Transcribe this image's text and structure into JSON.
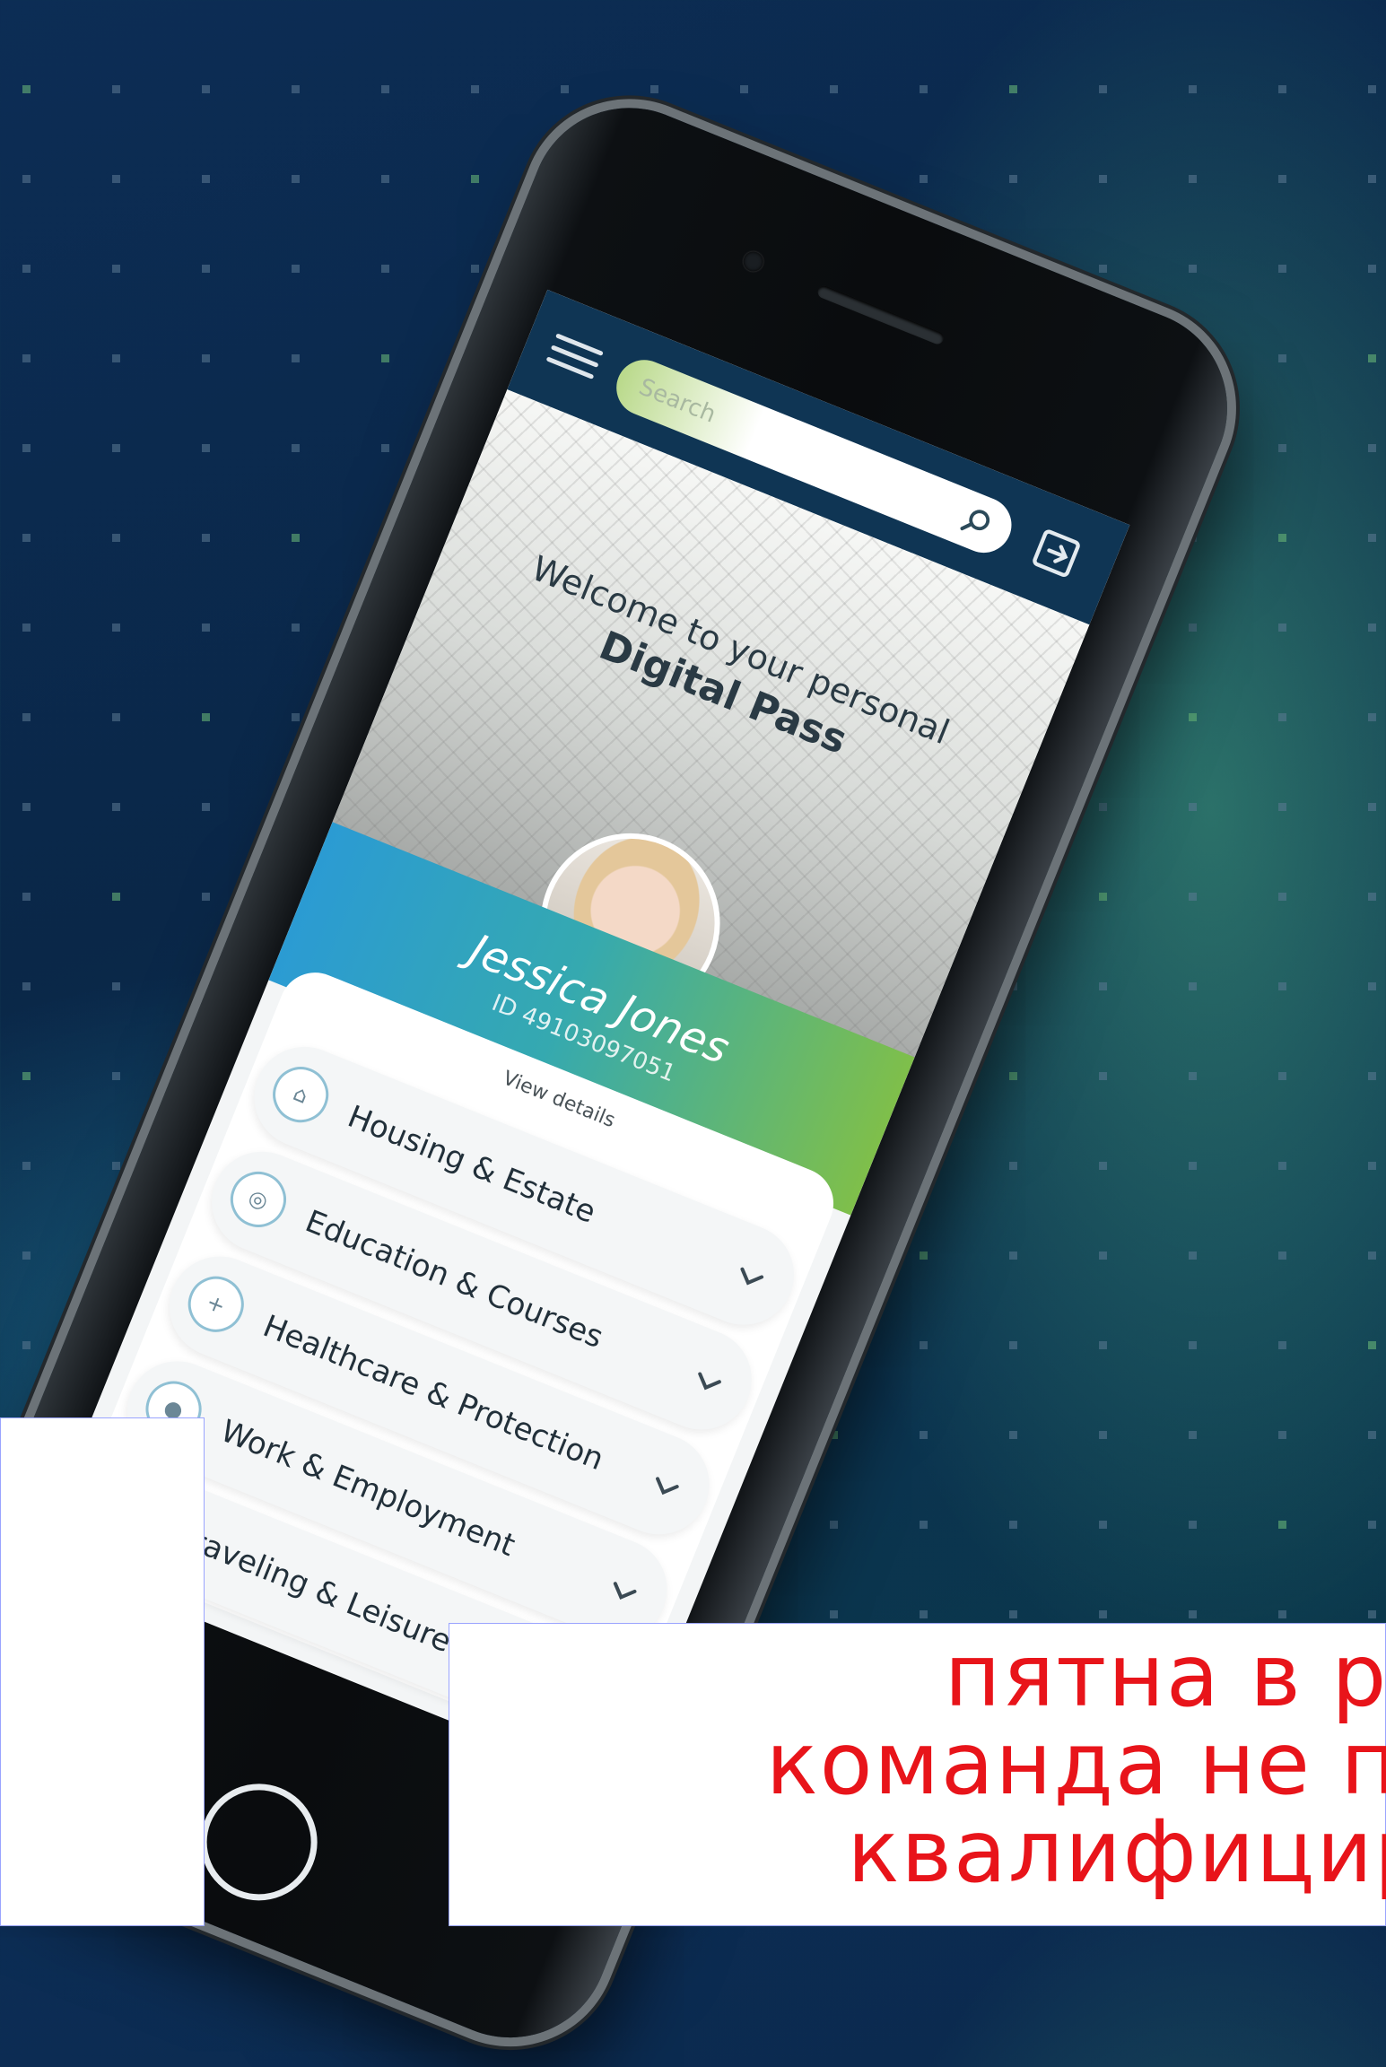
{
  "app": {
    "search": {
      "placeholder": "Search"
    },
    "welcome": {
      "line1": "Welcome to your personal",
      "line2": "Digital Pass"
    },
    "user": {
      "name": "Jessica Jones",
      "id": "ID 49103097051"
    },
    "view_details_label": "View details",
    "menu": [
      {
        "label": "Housing & Estate",
        "icon": "home-icon",
        "glyph": "⌂"
      },
      {
        "label": "Education & Courses",
        "icon": "graduation-icon",
        "glyph": "◎"
      },
      {
        "label": "Healthcare & Protection",
        "icon": "health-icon",
        "glyph": "+"
      },
      {
        "label": "Work & Employment",
        "icon": "briefcase-icon",
        "glyph": "●"
      },
      {
        "label": "Traveling & Leisure",
        "icon": "plane-icon",
        "glyph": "✈"
      }
    ]
  },
  "overlay": {
    "lines": [
      "пятна в р",
      "команда не подт",
      "квалифициро"
    ]
  },
  "colors": {
    "topbar": "#0f3554",
    "accent_blue": "#2b9bd3",
    "accent_green": "#7fbf4a",
    "overlay_text": "#e8141a"
  }
}
